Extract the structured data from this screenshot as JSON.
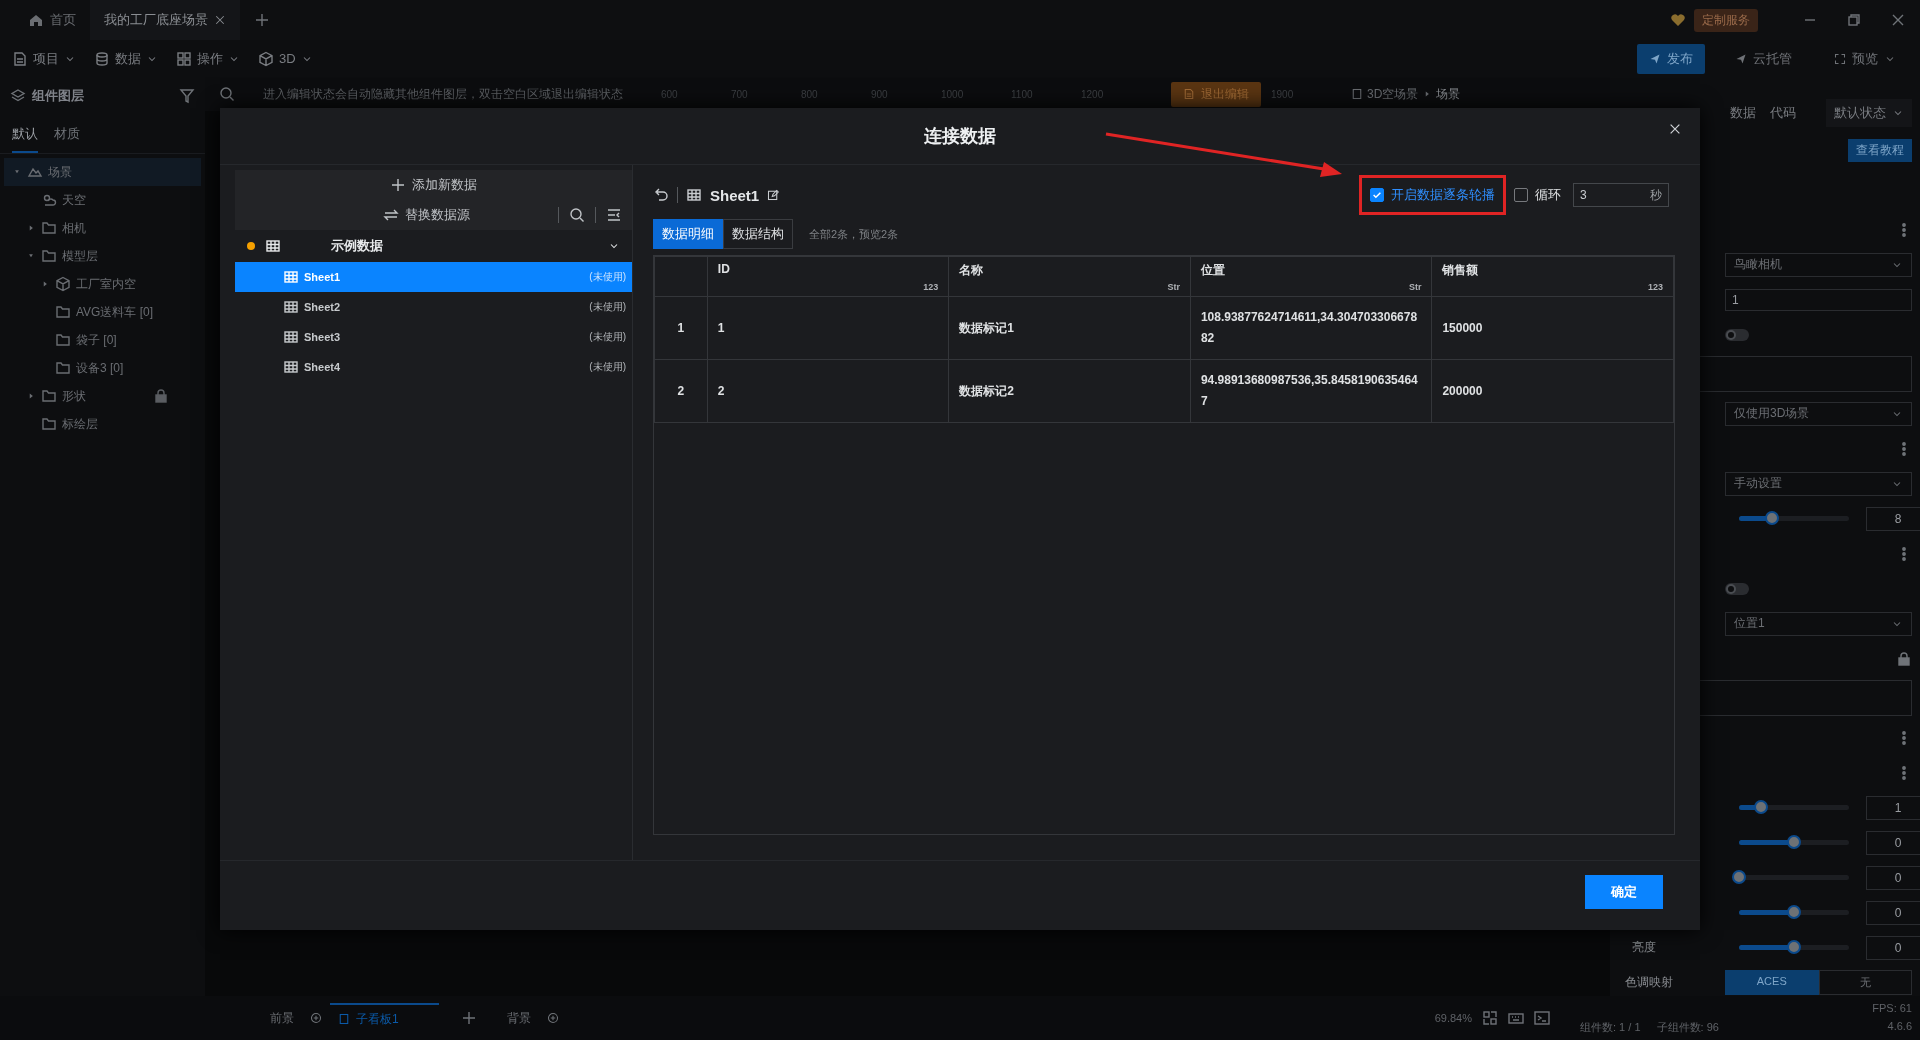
{
  "app_tabs": [
    {
      "label": "首页",
      "kind": "home",
      "selected": false
    },
    {
      "label": "我的工厂底座场景",
      "kind": "doc",
      "selected": true
    }
  ],
  "custom_service": "定制服务",
  "menu": [
    {
      "label": "项目",
      "kind": "file"
    },
    {
      "label": "数据",
      "kind": "db"
    },
    {
      "label": "操作",
      "kind": "grid"
    },
    {
      "label": "3D",
      "kind": "cube"
    }
  ],
  "actions": [
    {
      "label": "发布",
      "kind": "primary"
    },
    {
      "label": "云托管",
      "kind": "plain"
    },
    {
      "label": "预览",
      "kind": "menu"
    }
  ],
  "layers": {
    "title": "组件图层",
    "tabs": [
      {
        "label": "默认",
        "selected": true
      },
      {
        "label": "材质",
        "selected": false
      }
    ],
    "tree": [
      {
        "label": "场景",
        "kind": "scene",
        "expanded": true,
        "selected": true,
        "children": [
          {
            "label": "天空",
            "kind": "sky",
            "selected": false
          },
          {
            "label": "相机",
            "kind": "folder",
            "expanded": false,
            "selected": false
          },
          {
            "label": "模型层",
            "kind": "folder",
            "expanded": true,
            "selected": false,
            "children": [
              {
                "label": "工厂室内空",
                "kind": "cube",
                "expanded": false,
                "selected": false
              },
              {
                "label": "AVG送料车 [0]",
                "kind": "folder",
                "selected": false
              },
              {
                "label": "袋子 [0]",
                "kind": "folder",
                "selected": false
              },
              {
                "label": "设备3 [0]",
                "kind": "folder",
                "selected": false
              }
            ]
          },
          {
            "label": "形状",
            "kind": "folder",
            "expanded": false,
            "locked": true,
            "selected": false
          },
          {
            "label": "标绘层",
            "kind": "folder",
            "selected": false
          }
        ]
      }
    ]
  },
  "canvas": {
    "hint": "进入编辑状态会自动隐藏其他组件图层，双击空白区域退出编辑状态",
    "ruler": [
      "600",
      "700",
      "800",
      "900",
      "1000",
      "1100",
      "1200"
    ],
    "exit_button": "退出编辑",
    "ruler_end": "1900",
    "breadcrumb": [
      "3D空场景",
      "场景"
    ]
  },
  "inspector": {
    "tabs": [
      {
        "label": "数据"
      },
      {
        "label": "代码"
      }
    ],
    "state_select": "默认状态",
    "tutorial": "查看教程",
    "rows": [
      {
        "kind": "more"
      },
      {
        "kind": "select",
        "value": "鸟瞰相机"
      },
      {
        "kind": "input",
        "value": "1"
      },
      {
        "kind": "toggle",
        "on": false
      },
      {
        "kind": "blank"
      },
      {
        "kind": "select",
        "value": "仅使用3D场景"
      },
      {
        "kind": "more"
      },
      {
        "kind": "select",
        "value": "手动设置"
      },
      {
        "kind": "slider",
        "level": 0.3,
        "value": "8"
      },
      {
        "kind": "more"
      },
      {
        "kind": "toggle",
        "on": false
      },
      {
        "kind": "select",
        "value": "位置1"
      },
      {
        "kind": "lock"
      },
      {
        "kind": "blank"
      },
      {
        "kind": "more"
      },
      {
        "kind": "more"
      },
      {
        "kind": "slider",
        "level": 0.2,
        "value": "1"
      },
      {
        "kind": "slider",
        "level": 0.5,
        "value": "0"
      },
      {
        "kind": "slider",
        "level": 0,
        "value": "0"
      },
      {
        "kind": "slider",
        "level": 0.5,
        "value": "0"
      },
      {
        "kind": "slider",
        "label": "亮度",
        "level": 0.5,
        "value": "0"
      },
      {
        "kind": "segmented",
        "label": "色调映射",
        "options": [
          {
            "label": "ACES",
            "selected": true
          },
          {
            "label": "无",
            "selected": false
          }
        ]
      }
    ]
  },
  "dialog": {
    "title": "连接数据",
    "add_data": "添加新数据",
    "replace_source": "替换数据源",
    "source": {
      "name": "示例数据",
      "expanded": true,
      "sheets": [
        {
          "name": "Sheet1",
          "status": "(未使用)",
          "selected": true
        },
        {
          "name": "Sheet2",
          "status": "(未使用)",
          "selected": false
        },
        {
          "name": "Sheet3",
          "status": "(未使用)",
          "selected": false
        },
        {
          "name": "Sheet4",
          "status": "(未使用)",
          "selected": false
        }
      ]
    },
    "sheet_title": "Sheet1",
    "carousel": {
      "label": "开启数据逐条轮播",
      "checked": true,
      "highlighted": true
    },
    "loop": {
      "label": "循环",
      "checked": false
    },
    "interval": {
      "value": "3",
      "unit": "秒"
    },
    "view_tabs": [
      {
        "label": "数据明细",
        "selected": true
      },
      {
        "label": "数据结构",
        "selected": false
      }
    ],
    "summary": "全部2条，预览2条",
    "table": {
      "columns": [
        {
          "label": "ID",
          "type": "123"
        },
        {
          "label": "名称",
          "type": "Str"
        },
        {
          "label": "位置",
          "type": "Str"
        },
        {
          "label": "销售额",
          "type": "123"
        }
      ],
      "rows": [
        {
          "index": "1",
          "cells": [
            "1",
            "数据标记1",
            "108.93877624714611,34.30470330667882",
            "150000"
          ]
        },
        {
          "index": "2",
          "cells": [
            "2",
            "数据标记2",
            "94.98913680987536,35.84581906354647",
            "200000"
          ]
        }
      ]
    },
    "confirm": "确定"
  },
  "bottom": {
    "tabs": [
      {
        "label": "前景",
        "selected": false
      },
      {
        "label": "子看板1",
        "selected": true
      },
      {
        "label": "背景",
        "selected": false
      }
    ],
    "zoom": "69.84%",
    "fps": "FPS: 61",
    "components": "组件数: 1 / 1",
    "sub_components": "子组件数: 96",
    "version": "4.6.6"
  }
}
